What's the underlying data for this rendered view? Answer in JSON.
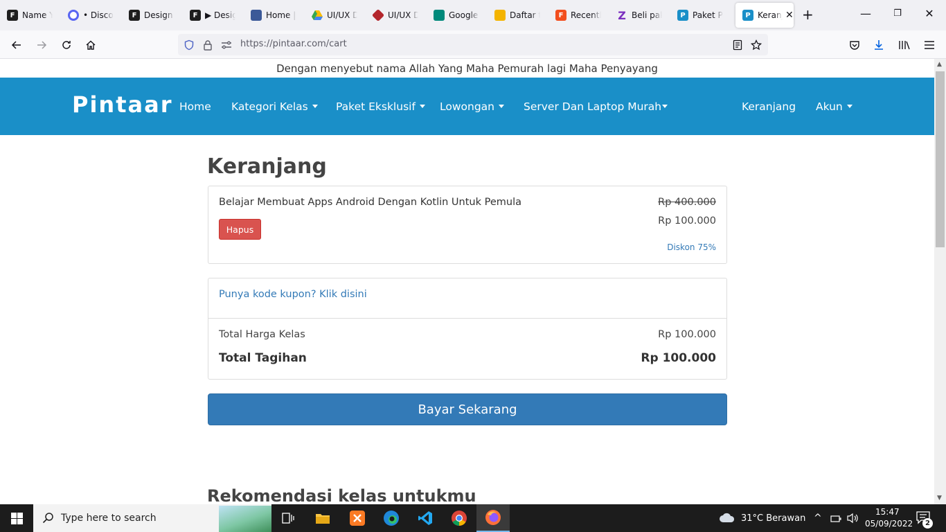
{
  "browser": {
    "tabs": [
      {
        "label": "Name Yo",
        "icon": "figma-icon",
        "color": "#1e1e1e"
      },
      {
        "label": "• Discord",
        "icon": "discord-icon",
        "color": "#5865f2"
      },
      {
        "label": "Design &",
        "icon": "figma-icon",
        "color": "#1e1e1e"
      },
      {
        "label": "▶ Design",
        "icon": "figma-icon",
        "color": "#1e1e1e"
      },
      {
        "label": "Home | I",
        "icon": "site-icon",
        "color": "#3b5998"
      },
      {
        "label": "UI/UX De",
        "icon": "drive-icon",
        "color": "#34a853"
      },
      {
        "label": "UI/UX De",
        "icon": "cube-icon",
        "color": "#b3262c"
      },
      {
        "label": "Google I",
        "icon": "meet-icon",
        "color": "#00897b"
      },
      {
        "label": "Daftar tu",
        "icon": "classroom-icon",
        "color": "#f4b400"
      },
      {
        "label": "Recently",
        "icon": "figma-icon",
        "color": "#f24e1e"
      },
      {
        "label": "Beli pak",
        "icon": "z-icon",
        "color": "#7b2fbf"
      },
      {
        "label": "Paket Pe",
        "icon": "pintaar-icon",
        "color": "#1a8fc8"
      },
      {
        "label": "Keranj",
        "icon": "pintaar-icon",
        "color": "#1a8fc8"
      }
    ],
    "url": "https://pintaar.com/cart"
  },
  "page": {
    "bismillah": "Dengan menyebut nama Allah Yang Maha Pemurah lagi Maha Penyayang",
    "brand": "Pintaar",
    "nav": {
      "home": "Home",
      "kategori": "Kategori Kelas",
      "paket": "Paket Eksklusif",
      "lowongan": "Lowongan",
      "server": "Server Dan Laptop Murah",
      "keranjang": "Keranjang",
      "akun": "Akun"
    },
    "heading": "Keranjang",
    "item": {
      "title": "Belajar Membuat Apps Android Dengan Kotlin Untuk Pemula",
      "remove_label": "Hapus",
      "old_price": "Rp 400.000",
      "price": "Rp 100.000",
      "discount": "Diskon 75%"
    },
    "summary": {
      "coupon_link": "Punya kode kupon? Klik disini",
      "subtotal_label": "Total Harga Kelas",
      "subtotal_value": "Rp 100.000",
      "total_label": "Total Tagihan",
      "total_value": "Rp 100.000"
    },
    "pay_label": "Bayar Sekarang",
    "recommend_heading": "Rekomendasi kelas untukmu"
  },
  "taskbar": {
    "search_placeholder": "Type here to search",
    "weather": "31°C  Berawan",
    "time": "15:47",
    "date": "05/09/2022",
    "notification_count": "2"
  },
  "colors": {
    "brand_bar": "#1a8fc8",
    "primary_button": "#337ab7",
    "danger_button": "#d9534f"
  }
}
